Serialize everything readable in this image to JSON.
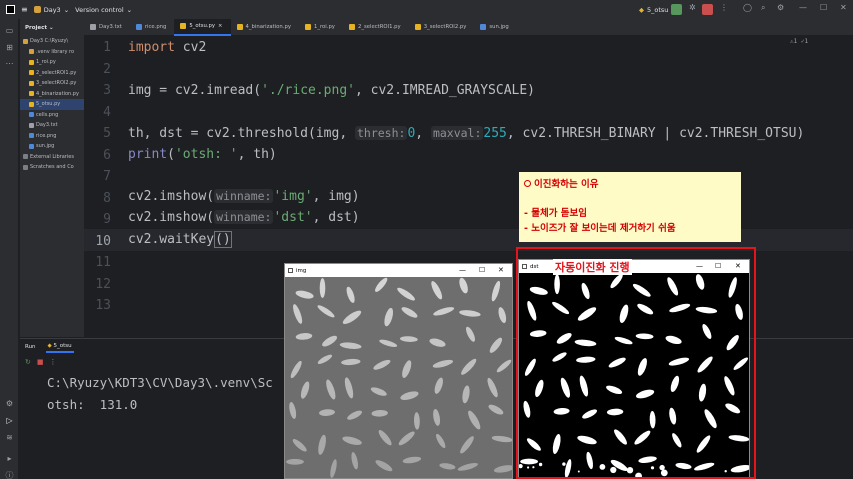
{
  "titlebar": {
    "project": "Day3",
    "vcs": "Version control",
    "run_config": "5_otsu"
  },
  "project_panel": {
    "header": "Project",
    "items": [
      {
        "label": "Day3  C:\\Ryuzy\\",
        "color": "#d6a13a",
        "indent": 3,
        "selected": false
      },
      {
        "label": ".venv  library ro",
        "color": "#d6a13a",
        "indent": 9,
        "selected": false
      },
      {
        "label": "1_roi.py",
        "color": "#e6b422",
        "indent": 9,
        "selected": false
      },
      {
        "label": "2_selectROI1.py",
        "color": "#e6b422",
        "indent": 9,
        "selected": false
      },
      {
        "label": "3_selectROI2.py",
        "color": "#e6b422",
        "indent": 9,
        "selected": false
      },
      {
        "label": "4_binarization.py",
        "color": "#e6b422",
        "indent": 9,
        "selected": false
      },
      {
        "label": "5_otsu.py",
        "color": "#e6b422",
        "indent": 9,
        "selected": true
      },
      {
        "label": "cells.png",
        "color": "#4f88d9",
        "indent": 9,
        "selected": false
      },
      {
        "label": "Day3.txt",
        "color": "#9da0a8",
        "indent": 9,
        "selected": false
      },
      {
        "label": "rice.png",
        "color": "#4f88d9",
        "indent": 9,
        "selected": false
      },
      {
        "label": "sun.jpg",
        "color": "#4f88d9",
        "indent": 9,
        "selected": false
      },
      {
        "label": "External Libraries",
        "color": "#7a7e85",
        "indent": 3,
        "selected": false
      },
      {
        "label": "Scratches and Co",
        "color": "#7a7e85",
        "indent": 3,
        "selected": false
      }
    ]
  },
  "tabs": [
    {
      "label": "Day3.txt",
      "color": "#9da0a8",
      "active": false
    },
    {
      "label": "rice.png",
      "color": "#4f88d9",
      "active": false
    },
    {
      "label": "5_otsu.py",
      "color": "#e6b422",
      "active": true
    },
    {
      "label": "4_binarization.py",
      "color": "#e6b422",
      "active": false
    },
    {
      "label": "1_roi.py",
      "color": "#e6b422",
      "active": false
    },
    {
      "label": "2_selectROI1.py",
      "color": "#e6b422",
      "active": false
    },
    {
      "label": "3_selectROI2.py",
      "color": "#e6b422",
      "active": false
    },
    {
      "label": "sun.jpg",
      "color": "#4f88d9",
      "active": false
    }
  ],
  "editor": {
    "line_numbers": [
      "1",
      "2",
      "3",
      "4",
      "5",
      "6",
      "7",
      "8",
      "9",
      "10",
      "11",
      "12",
      "13"
    ],
    "inspections": "⚠1 ✓1",
    "code": {
      "l1_kw": "import",
      "l1_rest": " cv2",
      "l3_a": "img = cv2.imread(",
      "l3_str": "'./rice.png'",
      "l3_b": ", cv2.IMREAD_GRAYSCALE)",
      "l5_a": "th, dst = cv2.threshold(img, ",
      "l5_hint1": "thresh:",
      "l5_num1": "0",
      "l5_b": ", ",
      "l5_hint2": "maxval:",
      "l5_num2": "255",
      "l5_c": ", cv2.THRESH_BINARY | cv2.THRESH_OTSU)",
      "l6_fn": "print",
      "l6_a": "(",
      "l6_str": "'otsh: '",
      "l6_b": ", th)",
      "l8_a": "cv2.imshow(",
      "l8_hint": "winname:",
      "l8_str": "'img'",
      "l8_b": ", img)",
      "l9_a": "cv2.imshow(",
      "l9_hint": "winname:",
      "l9_str": "'dst'",
      "l9_b": ", dst)",
      "l10_a": "cv2.waitKey",
      "l10_b": "()"
    }
  },
  "run_panel": {
    "tab_run": "Run",
    "tab_config": "5_otsu",
    "console_line1": "C:\\Ryuzy\\KDT3\\CV\\Day3\\.venv\\Sc",
    "console_line2": "otsh:  131.0"
  },
  "windows": {
    "img_title": "img",
    "dst_title": "dst"
  },
  "annotation": {
    "title": "이진화하는 이유",
    "bullet1": "- 물체가 돋보임",
    "bullet2": "- 노이즈가 잘 보이는데 제거하기 쉬움",
    "red_label": "자동이진화 진행"
  }
}
